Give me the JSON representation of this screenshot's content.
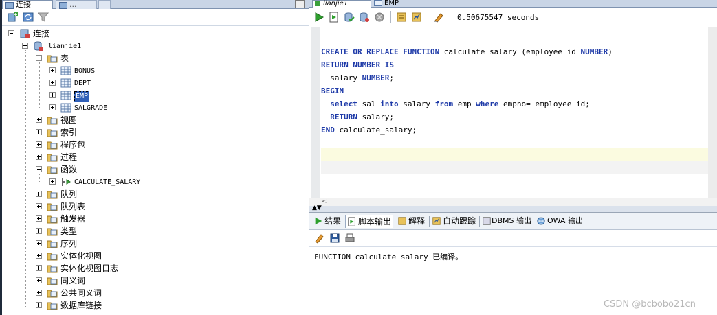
{
  "left_panel": {
    "tabs": [
      {
        "label": "连接"
      },
      {
        "label": "..."
      },
      {
        "label": ""
      }
    ],
    "tree": {
      "root": "连接",
      "connection": "lianjie1",
      "tables_group": "表",
      "tables": [
        "BONUS",
        "DEPT",
        "EMP",
        "SALGRADE"
      ],
      "selected_table": "EMP",
      "groups_before_func": [
        "视图",
        "索引",
        "程序包",
        "过程"
      ],
      "functions_group": "函数",
      "functions": [
        "CALCULATE_SALARY"
      ],
      "groups_after_func": [
        "队列",
        "队列表",
        "触发器",
        "类型",
        "序列",
        "实体化视图",
        "实体化视图日志",
        "同义词",
        "公共同义词",
        "数据库链接"
      ]
    }
  },
  "editor": {
    "tabs": [
      {
        "label": "lianjie1"
      },
      {
        "label": "EMP"
      }
    ],
    "timing": "0.50675547 seconds",
    "code_lines": [
      [
        {
          "t": "CREATE OR REPLACE FUNCTION",
          "k": true
        },
        {
          "t": " calculate_salary (employee_id ",
          "k": false
        },
        {
          "t": "NUMBER",
          "k": true
        },
        {
          "t": ")",
          "k": false
        }
      ],
      [
        {
          "t": "RETURN NUMBER IS",
          "k": true
        }
      ],
      [
        {
          "t": "  salary ",
          "k": false
        },
        {
          "t": "NUMBER",
          "k": true
        },
        {
          "t": ";",
          "k": false
        }
      ],
      [
        {
          "t": "BEGIN",
          "k": true
        }
      ],
      [
        {
          "t": "  ",
          "k": false
        },
        {
          "t": "select",
          "k": true
        },
        {
          "t": " sal ",
          "k": false
        },
        {
          "t": "into",
          "k": true
        },
        {
          "t": " salary ",
          "k": false
        },
        {
          "t": "from",
          "k": true
        },
        {
          "t": " emp ",
          "k": false
        },
        {
          "t": "where",
          "k": true
        },
        {
          "t": " empno= employee_id;",
          "k": false
        }
      ],
      [
        {
          "t": "  ",
          "k": false
        },
        {
          "t": "RETURN",
          "k": true
        },
        {
          "t": " salary;",
          "k": false
        }
      ],
      [
        {
          "t": "END",
          "k": true
        },
        {
          "t": " calculate_salary;",
          "k": false
        }
      ]
    ]
  },
  "output_panel": {
    "tabs": [
      {
        "label": "结果"
      },
      {
        "label": "脚本输出"
      },
      {
        "label": "解释"
      },
      {
        "label": "自动跟踪"
      },
      {
        "label": "DBMS 输出"
      },
      {
        "label": "OWA 输出"
      }
    ],
    "message": "FUNCTION calculate_salary 已编译。"
  },
  "watermark": "CSDN @bcbobo21cn",
  "colors": {
    "keyword": "#1e3aa8",
    "selection": "#3060b8",
    "current_line": "#fbfbe0"
  }
}
